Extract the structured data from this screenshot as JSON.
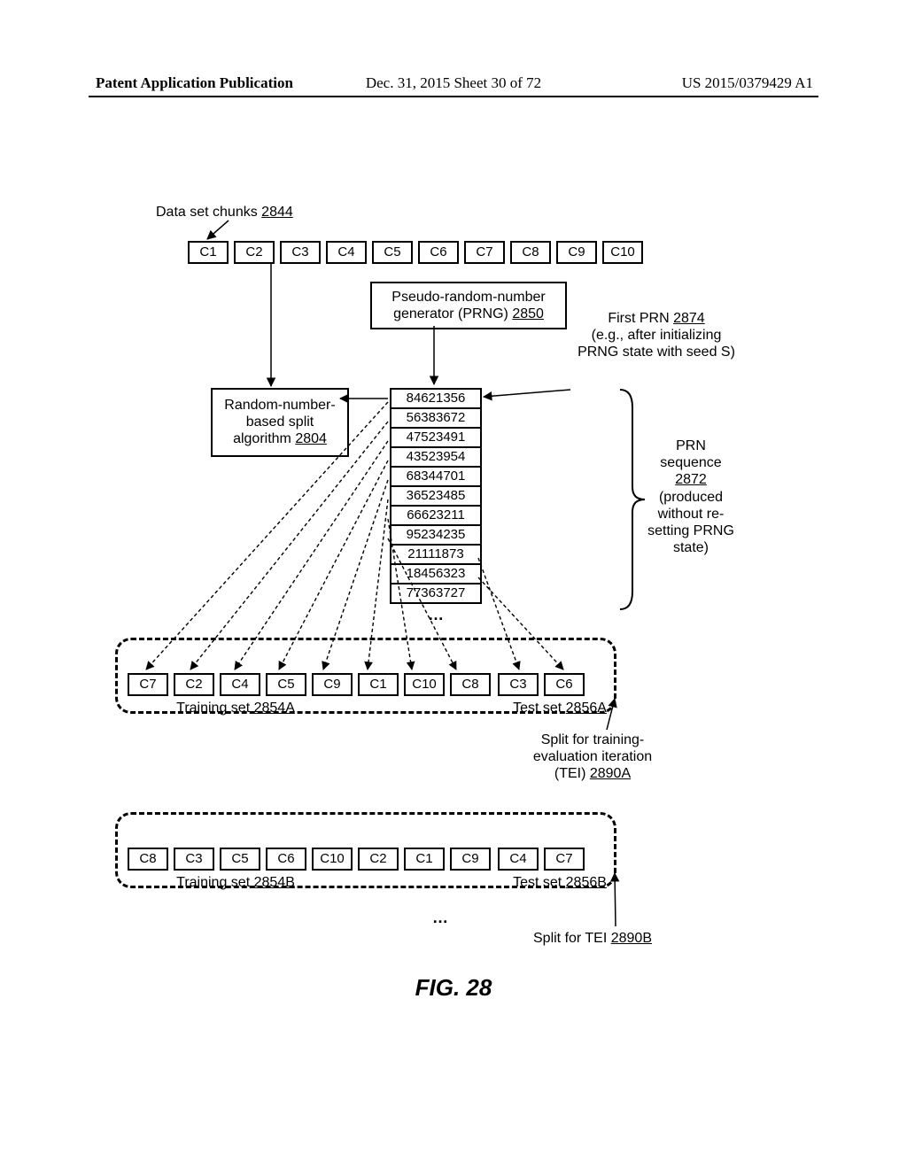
{
  "header": {
    "left": "Patent Application Publication",
    "center": "Dec. 31, 2015  Sheet 30 of 72",
    "right": "US 2015/0379429 A1"
  },
  "figure_label": "FIG. 28",
  "labels": {
    "dataset_chunks": "Data set chunks ",
    "dataset_chunks_ref": "2844",
    "prng": "Pseudo-random-number generator (PRNG) ",
    "prng_ref": "2850",
    "algo": "Random-number-based split algorithm ",
    "algo_ref": "2804",
    "first_prn_l1": "First PRN ",
    "first_prn_ref": "2874",
    "first_prn_l2": "(e.g., after initializing PRNG state with seed S)",
    "seq_l1": "PRN sequence ",
    "seq_ref": "2872",
    "seq_l2": "(produced without re-setting PRNG state)",
    "trainA": "Training set ",
    "trainA_ref": "2854A",
    "testA": "Test set ",
    "testA_ref": "2856A",
    "splitA_l1": "Split for training-evaluation iteration (TEI)  ",
    "splitA_ref": "2890A",
    "trainB": "Training set ",
    "trainB_ref": "2854B",
    "testB": "Test set ",
    "testB_ref": "2856B",
    "splitB": "Split for TEI  ",
    "splitB_ref": "2890B",
    "ellipsis": "…"
  },
  "chunks_top": [
    "C1",
    "C2",
    "C3",
    "C4",
    "C5",
    "C6",
    "C7",
    "C8",
    "C9",
    "C10"
  ],
  "prn": [
    "84621356",
    "56383672",
    "47523491",
    "43523954",
    "68344701",
    "36523485",
    "66623211",
    "95234235",
    "21111873",
    "18456323",
    "77363727",
    "…"
  ],
  "splitA": {
    "train": [
      "C7",
      "C2",
      "C4",
      "C5",
      "C9",
      "C1",
      "C10",
      "C8"
    ],
    "test": [
      "C3",
      "C6"
    ]
  },
  "splitB": {
    "train": [
      "C8",
      "C3",
      "C5",
      "C6",
      "C10",
      "C2",
      "C1",
      "C9"
    ],
    "test": [
      "C4",
      "C7"
    ]
  }
}
